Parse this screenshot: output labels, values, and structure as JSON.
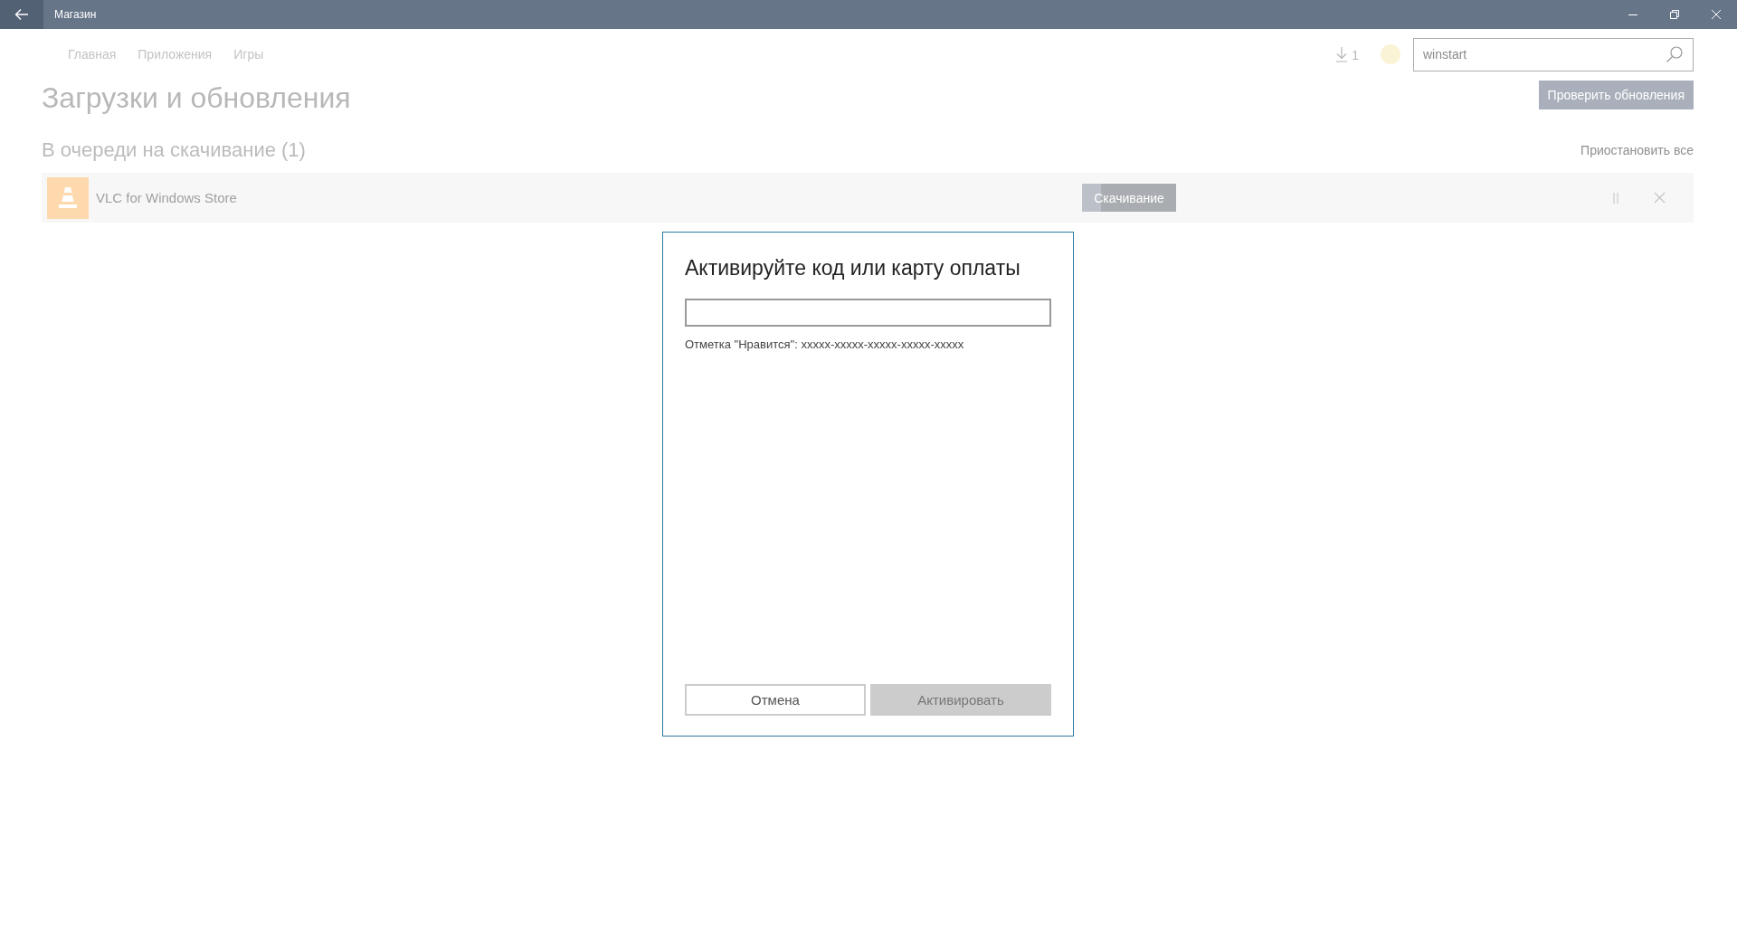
{
  "window": {
    "title": "Магазин"
  },
  "nav": {
    "items": [
      {
        "label": "Главная",
        "selected": false
      },
      {
        "label": "Приложения",
        "selected": false
      },
      {
        "label": "Игры",
        "selected": false
      }
    ]
  },
  "downloads": {
    "count": "1"
  },
  "search": {
    "value": "winstart"
  },
  "check_updates_button": "Проверить обновления",
  "page_title": "Загрузки и обновления",
  "queue": {
    "heading": "В очереди на скачивание (1)",
    "pause_all": "Приостановить все",
    "items": [
      {
        "name": "VLC for Windows Store",
        "status": "Скачивание",
        "level": 0.2
      }
    ]
  },
  "dialog": {
    "title": "Активируйте код или карту оплаты",
    "hint": "Отметка \"Нравится\": xxxxx-xxxxx-xxxxx-xxxxx-xxxxx",
    "buttons": [
      {
        "label": "Отмена",
        "disabled": false
      },
      {
        "label": "Активировать",
        "disabled": true
      }
    ]
  }
}
